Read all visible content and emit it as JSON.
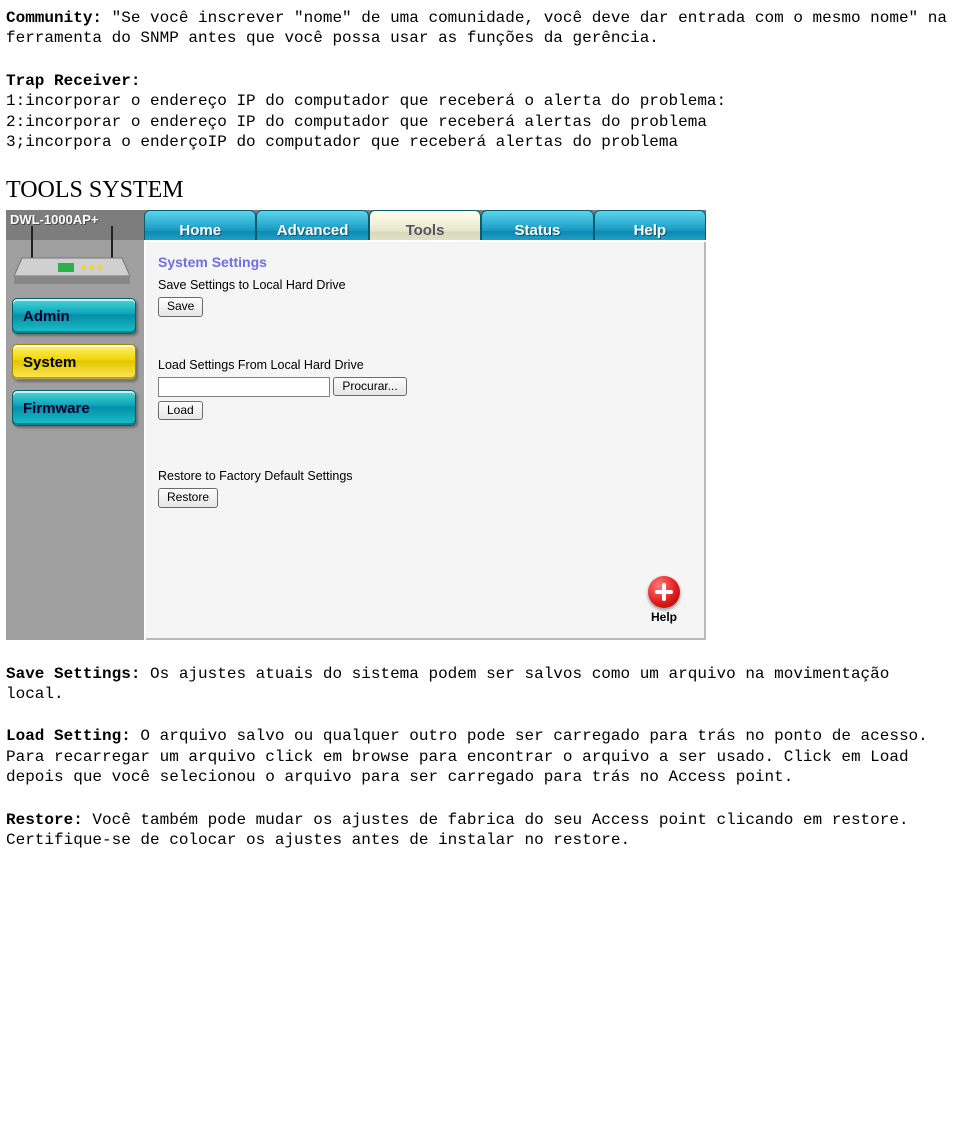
{
  "p1": {
    "label": "Community:",
    "text": " \"Se você inscrever \"nome\" de uma comunidade, você deve dar entrada com o mesmo nome\" na ferramenta do SNMP antes que você possa usar as funções da gerência."
  },
  "p2": {
    "label": "Trap Receiver:",
    "line1": "1:incorporar o endereço IP do computador que receberá o alerta do problema:",
    "line2": "2:incorporar o endereço IP do computador que receberá alertas do problema",
    "line3": "3;incorpora o enderçoIP do computador que receberá alertas do problema"
  },
  "heading": "TOOLS SYSTEM",
  "shot": {
    "device_label": "DWL-1000AP+",
    "tabs": [
      "Home",
      "Advanced",
      "Tools",
      "Status",
      "Help"
    ],
    "side": [
      "Admin",
      "System",
      "Firmware"
    ],
    "section_title": "System Settings",
    "save_label": "Save Settings to Local Hard Drive",
    "save_btn": "Save",
    "load_label": "Load Settings From Local Hard Drive",
    "browse_btn": "Procurar...",
    "load_btn": "Load",
    "restore_label": "Restore to Factory Default Settings",
    "restore_btn": "Restore",
    "help_label": "Help"
  },
  "p3": {
    "label": "Save Settings:",
    "text": " Os ajustes atuais do sistema podem ser salvos como um arquivo na movimentação local."
  },
  "p4": {
    "label": "Load Setting:",
    "text": " O arquivo salvo ou qualquer outro pode ser carregado para trás no ponto de acesso. Para recarregar um arquivo click em browse para encontrar o arquivo a ser usado. Click em Load depois que você selecionou o arquivo para ser carregado para trás no Access point."
  },
  "p5": {
    "label": "Restore:",
    "text": " Você também pode mudar os ajustes de fabrica do seu Access point clicando em restore. Certifique-se de colocar os ajustes antes de instalar no restore."
  }
}
